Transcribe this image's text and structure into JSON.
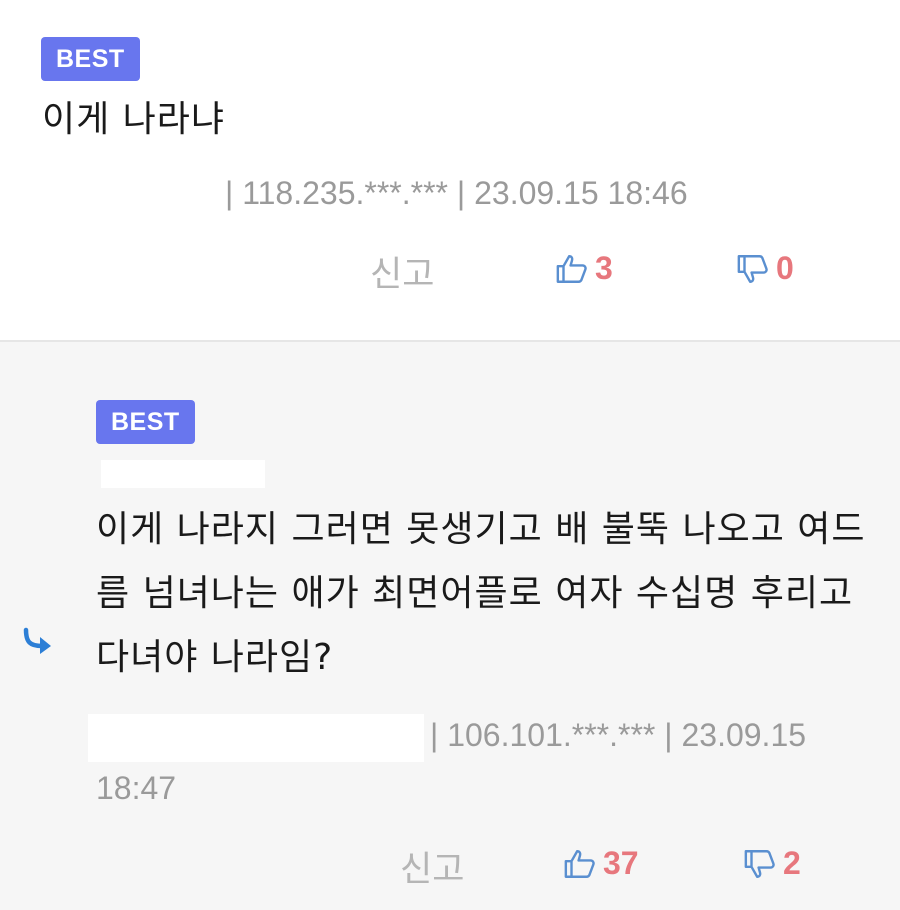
{
  "comments": [
    {
      "badge": "BEST",
      "text": "이게 나라냐",
      "ip_line": "| 118.235.***.*** | 23.09.15 18:46",
      "report_label": "신고",
      "likes": "3",
      "dislikes": "0",
      "thumb_icon": "thumbs-up-icon",
      "thumb_down_icon": "thumbs-down-icon"
    },
    {
      "badge": "BEST",
      "text": "이게 나라지 그러면 못생기고 배 불뚝 나오고 여드름 넘녀나는 애가 최면어플로 여자 수십명 후리고 다녀야 나라임?",
      "ip_line": "| 106.101.***.*** | 23.09.15",
      "time_line": "18:47",
      "report_label": "신고",
      "likes": "37",
      "dislikes": "2",
      "reply_icon": "reply-arrow-icon"
    }
  ],
  "colors": {
    "badge": "#6876ee",
    "count": "#e7777d",
    "icon": "#5a8fd0",
    "meta": "#9a9a9a"
  }
}
